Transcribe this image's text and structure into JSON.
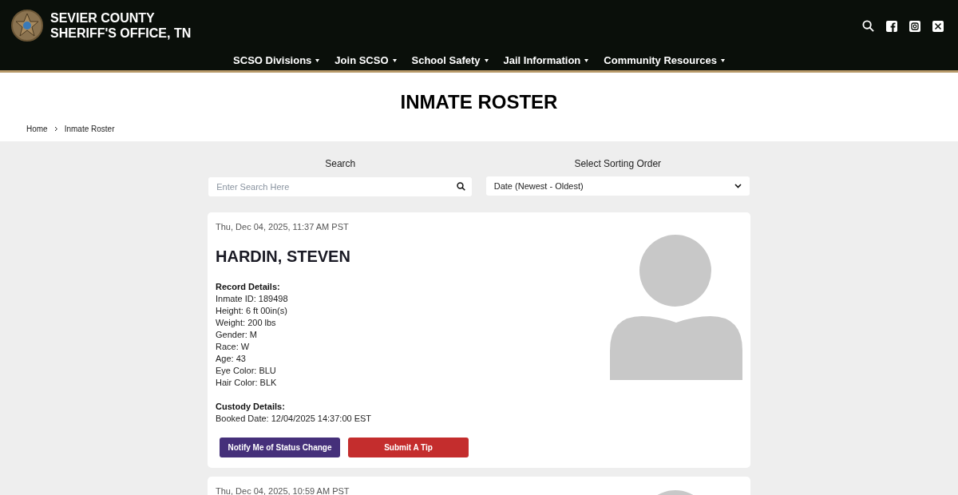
{
  "header": {
    "title_lines": [
      "SEVIER COUNTY",
      "SHERIFF'S OFFICE, TN"
    ],
    "nav": [
      {
        "label": "SCSO Divisions"
      },
      {
        "label": "Join SCSO"
      },
      {
        "label": "School Safety"
      },
      {
        "label": "Jail Information"
      },
      {
        "label": "Community Resources"
      }
    ]
  },
  "page_title": "INMATE ROSTER",
  "breadcrumb": [
    "Home",
    "Inmate Roster"
  ],
  "search": {
    "label": "Search",
    "placeholder": "Enter Search Here"
  },
  "sort": {
    "label": "Select Sorting Order",
    "value": "Date (Newest - Oldest)"
  },
  "inmates": [
    {
      "date": "Thu, Dec 04, 2025, 11:37 AM PST",
      "name": "HARDIN, STEVEN",
      "sections": [
        {
          "heading": "Record Details:",
          "lines": [
            "Inmate ID: 189498",
            "Height: 6 ft 00in(s)",
            "Weight: 200 lbs",
            "Gender: M",
            "Race: W",
            "Age: 43",
            "Eye Color: BLU",
            "Hair Color: BLK"
          ]
        },
        {
          "heading": "Custody Details:",
          "lines": [
            "Booked Date: 12/04/2025 14:37:00 EST"
          ]
        }
      ],
      "buttons": [
        {
          "label": "Notify Me of Status Change",
          "kind": "notify"
        },
        {
          "label": "Submit A Tip",
          "kind": "tip"
        }
      ]
    },
    {
      "date": "Thu, Dec 04, 2025, 10:59 AM PST"
    }
  ]
}
